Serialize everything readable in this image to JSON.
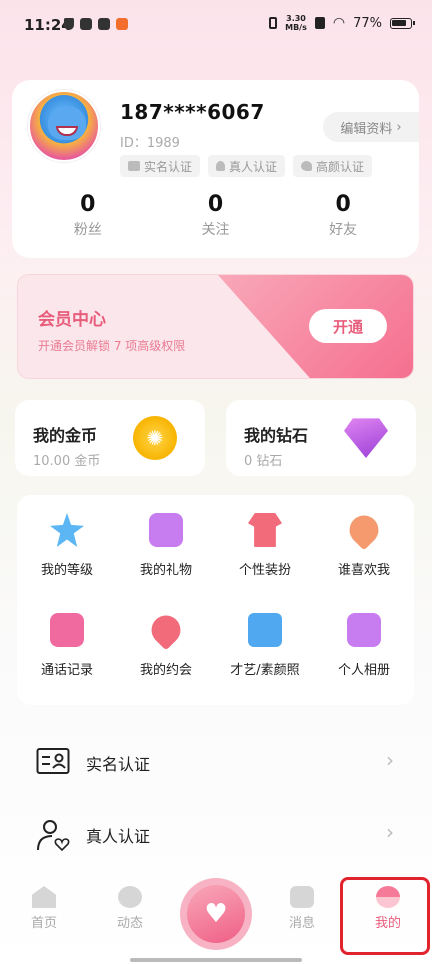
{
  "status_bar": {
    "time": "11:24",
    "network_speed": "3.30\nMB/s",
    "battery": "77%"
  },
  "profile": {
    "phone": "187****6067",
    "id": "ID：1989",
    "edit_label": "编辑资料",
    "badges": [
      "实名认证",
      "真人认证",
      "高颜认证"
    ],
    "stats": [
      {
        "value": "0",
        "label": "粉丝"
      },
      {
        "value": "0",
        "label": "关注"
      },
      {
        "value": "0",
        "label": "好友"
      }
    ]
  },
  "vip": {
    "title": "会员中心",
    "subtitle": "开通会员解锁 7 项高级权限",
    "button_label": "开通"
  },
  "wallet": {
    "coins": {
      "title": "我的金币",
      "value": "10.00 金币"
    },
    "diamonds": {
      "title": "我的钻石",
      "value": "0 钻石"
    }
  },
  "features": [
    {
      "label": "我的等级",
      "icon": "star-icon",
      "color": "#5bb6f3"
    },
    {
      "label": "我的礼物",
      "icon": "gift-icon",
      "color": "#c77df0"
    },
    {
      "label": "个性装扮",
      "icon": "shirt-icon",
      "color": "#f26b7a"
    },
    {
      "label": "谁喜欢我",
      "icon": "heart-icon",
      "color": "#f59a6e"
    },
    {
      "label": "通话记录",
      "icon": "call-record-icon",
      "color": "#f06aa0"
    },
    {
      "label": "我的约会",
      "icon": "handshake-icon",
      "color": "#f26b7a"
    },
    {
      "label": "才艺/素颜照",
      "icon": "video-icon",
      "color": "#4fa8f0"
    },
    {
      "label": "个人相册",
      "icon": "album-icon",
      "color": "#c77df0"
    }
  ],
  "list": [
    {
      "label": "实名认证",
      "icon": "id-card-icon"
    },
    {
      "label": "真人认证",
      "icon": "person-verify-icon"
    }
  ],
  "tabs": [
    {
      "label": "首页",
      "icon": "home-icon"
    },
    {
      "label": "动态",
      "icon": "planet-icon"
    },
    {
      "label": "消息",
      "icon": "message-icon"
    },
    {
      "label": "我的",
      "icon": "profile-icon"
    }
  ],
  "colors": {
    "accent": "#e85d7c",
    "highlight": "#e0232d"
  }
}
